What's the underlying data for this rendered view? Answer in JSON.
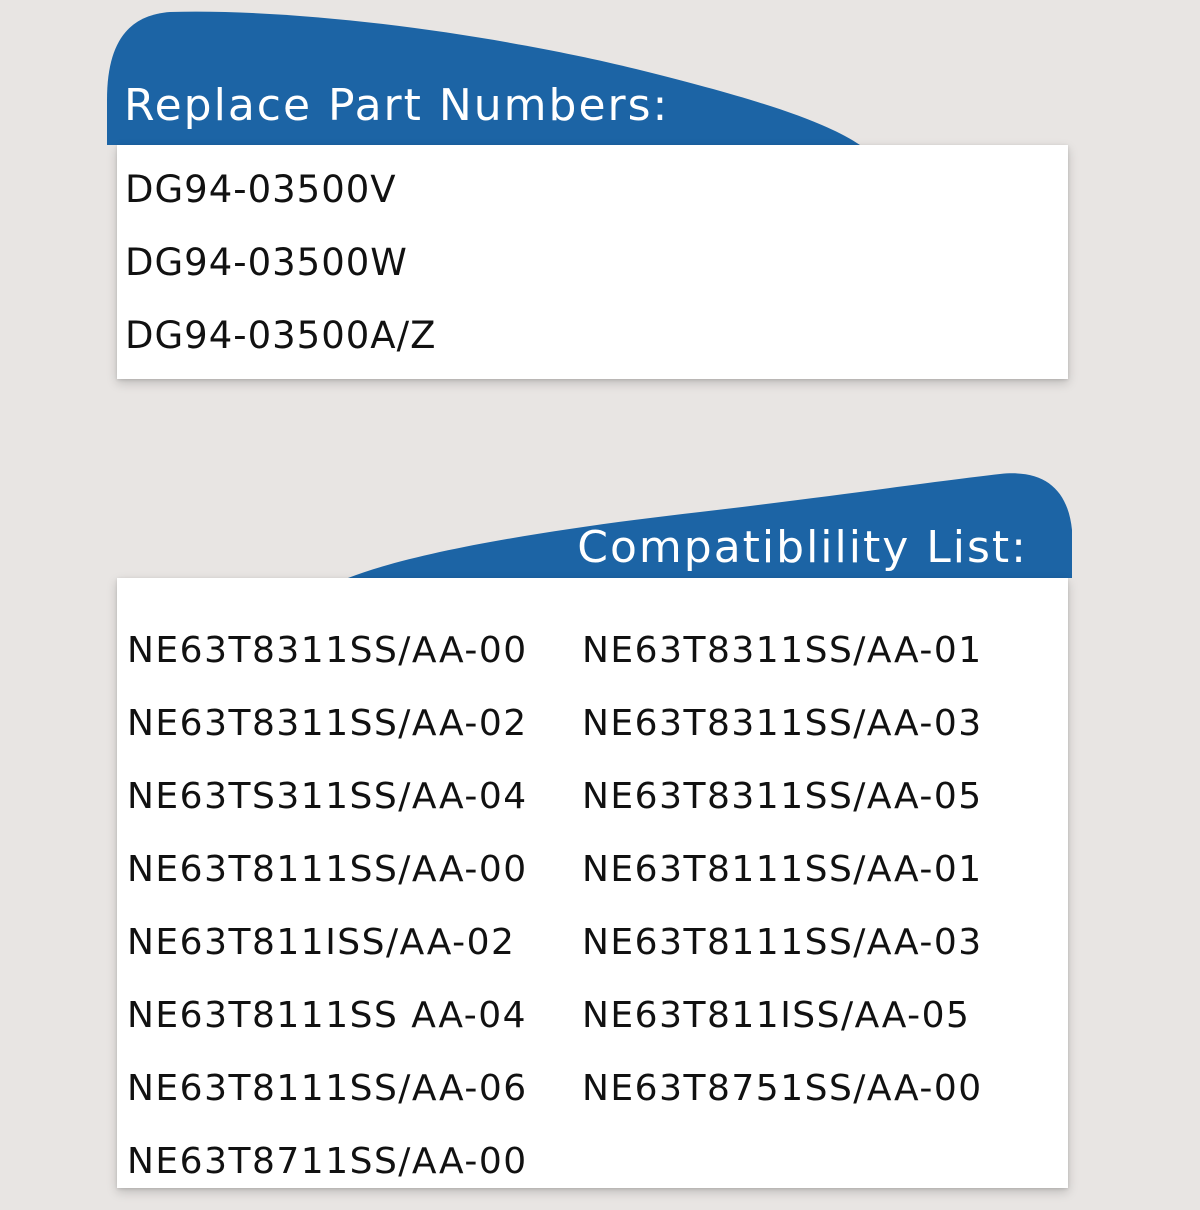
{
  "colors": {
    "background": "#e8e5e3",
    "accent_blue": "#1c64a5",
    "panel": "#ffffff",
    "text": "#111111"
  },
  "replace_section": {
    "title": "Replace Part Numbers:",
    "items": [
      "DG94-03500V",
      "DG94-03500W",
      "DG94-03500A/Z"
    ]
  },
  "compat_section": {
    "title": "Compatiblility List:",
    "items": [
      "NE63T8311SS/AA-00",
      "NE63T8311SS/AA-01",
      "NE63T8311SS/AA-02",
      "NE63T8311SS/AA-03",
      "NE63TS311SS/AA-04",
      "NE63T8311SS/AA-05",
      "NE63T8111SS/AA-00",
      "NE63T8111SS/AA-01",
      "NE63T811ISS/AA-02",
      "NE63T8111SS/AA-03",
      "NE63T8111SS AA-04",
      "NE63T811ISS/AA-05",
      "NE63T8111SS/AA-06",
      "NE63T8751SS/AA-00",
      "NE63T8711SS/AA-00"
    ]
  }
}
